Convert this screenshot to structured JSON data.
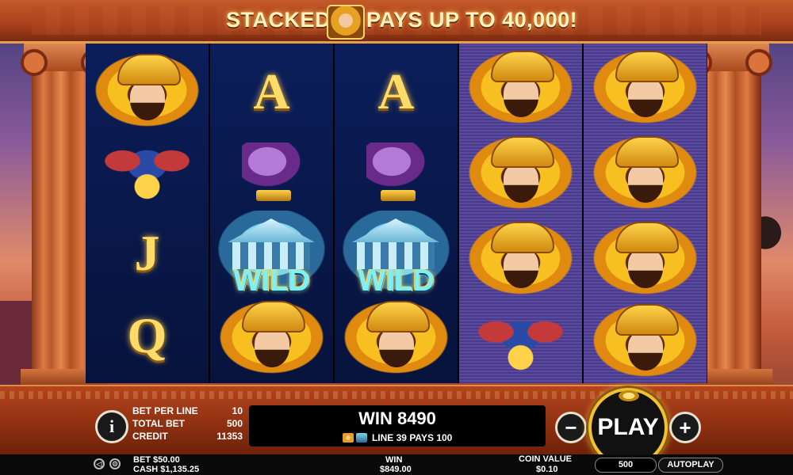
{
  "banner": {
    "text_left": "STACKED",
    "text_right": "PAYS UP TO 40,000!",
    "icon": "hercules-lion-icon"
  },
  "reels": [
    [
      "lion-hero",
      "three-headed-dog",
      "J",
      "Q"
    ],
    [
      "A",
      "eagle",
      "WILD",
      "lion-hero"
    ],
    [
      "A",
      "eagle",
      "WILD",
      "lion-hero"
    ],
    [
      "lion-hero",
      "lion-hero",
      "lion-hero",
      "three-headed-dog"
    ],
    [
      "lion-hero",
      "lion-hero",
      "lion-hero",
      "lion-hero"
    ]
  ],
  "symbols": {
    "J": "J",
    "Q": "Q",
    "A": "A",
    "wild": "WILD"
  },
  "console": {
    "info_label": "i",
    "bet_per_line_label": "BET PER LINE",
    "bet_per_line_value": "10",
    "total_bet_label": "TOTAL BET",
    "total_bet_value": "500",
    "credit_label": "CREDIT",
    "credit_value": "11353",
    "win_title": "WIN 8490",
    "win_line": "LINE 39 PAYS 100",
    "minus_label": "−",
    "plus_label": "+",
    "play_label": "PLAY"
  },
  "status_bar": {
    "bet": "BET $50.00",
    "cash": "CASH $1,135.25",
    "win_label": "WIN",
    "win_value": "$849.00",
    "coin_value_label": "COIN VALUE",
    "coin_value": "$0.10",
    "coin_select": "500",
    "autoplay": "AUTOPLAY"
  },
  "colors": {
    "accent_gold": "#f2c030",
    "console_red": "#b4451c"
  }
}
